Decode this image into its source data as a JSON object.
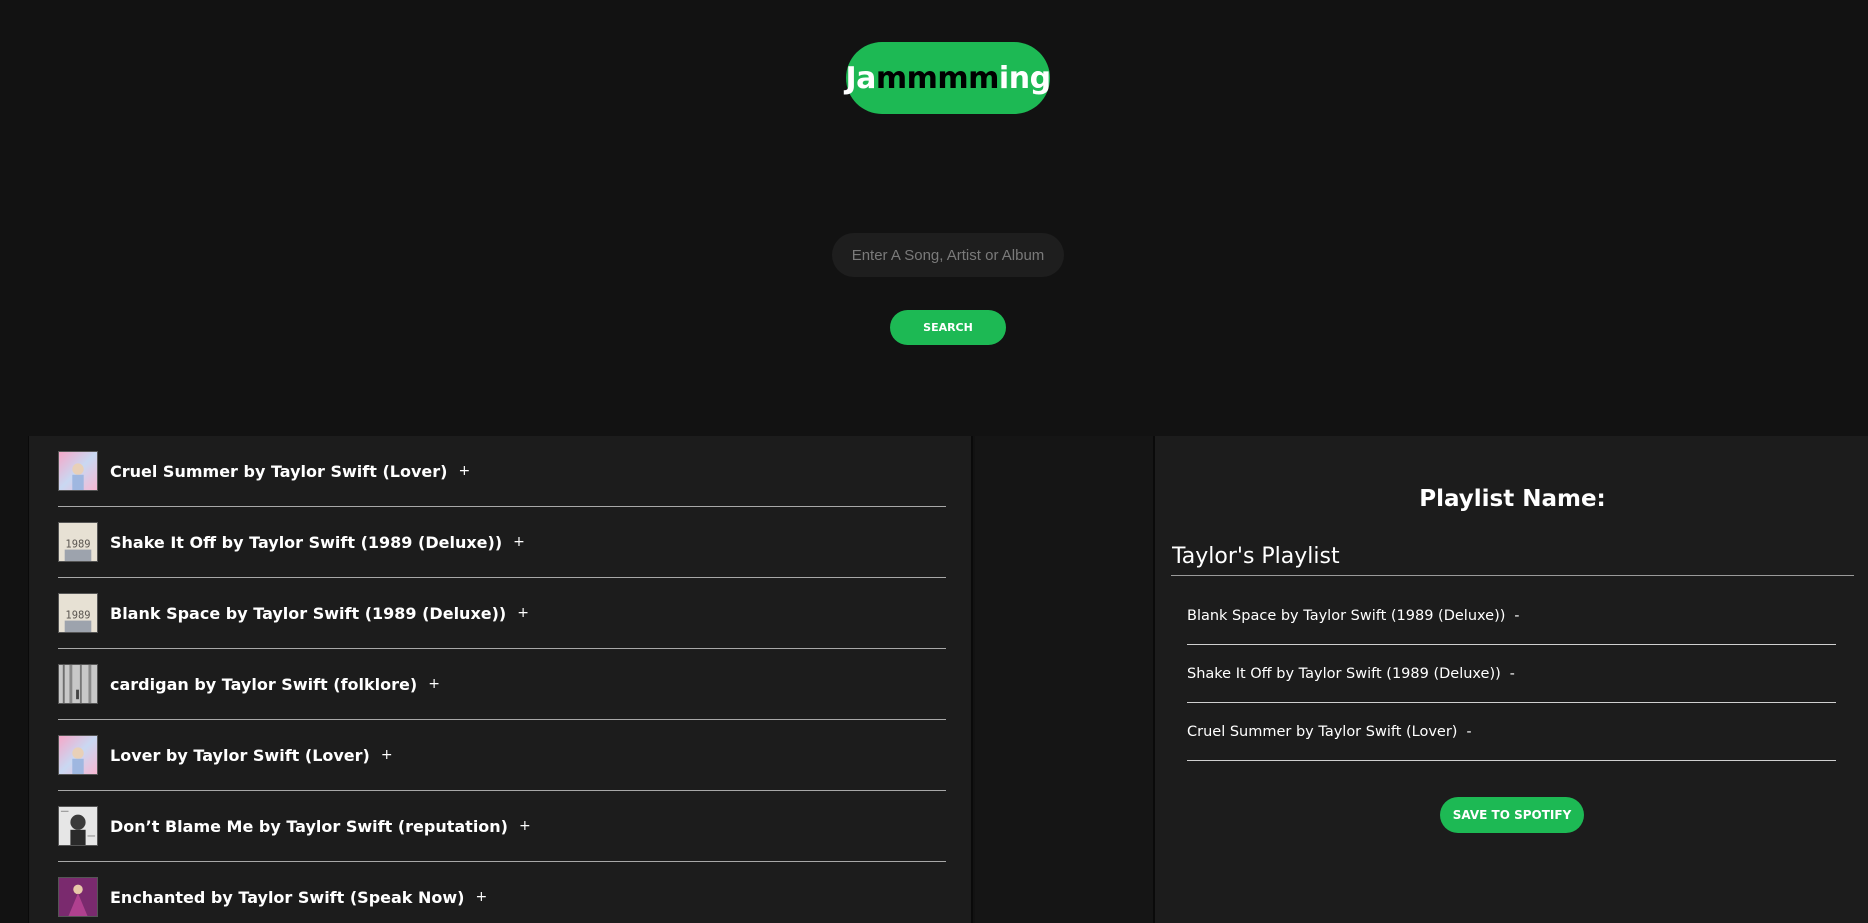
{
  "app": {
    "logo_part1": "Ja",
    "logo_part2": "mmmm",
    "logo_part3": "ing",
    "accent_color": "#1db954"
  },
  "search": {
    "placeholder": "Enter A Song, Artist or Album",
    "button_label": "Search"
  },
  "results": [
    {
      "title": "Cruel Summer by Taylor Swift (Lover)",
      "art": "lover-album-art",
      "add_label": "+"
    },
    {
      "title": "Shake It Off by Taylor Swift (1989 (Deluxe))",
      "art": "1989-album-art",
      "add_label": "+"
    },
    {
      "title": "Blank Space by Taylor Swift (1989 (Deluxe))",
      "art": "1989-album-art",
      "add_label": "+"
    },
    {
      "title": "cardigan by Taylor Swift (folklore)",
      "art": "folklore-album-art",
      "add_label": "+"
    },
    {
      "title": "Lover by Taylor Swift (Lover)",
      "art": "lover-album-art",
      "add_label": "+"
    },
    {
      "title": "Don’t Blame Me by Taylor Swift (reputation)",
      "art": "reputation-album-art",
      "add_label": "+"
    },
    {
      "title": "Enchanted by Taylor Swift (Speak Now)",
      "art": "speak-now-album-art",
      "add_label": "+"
    }
  ],
  "playlist": {
    "label": "Playlist Name:",
    "name_value": "Taylor's Playlist",
    "tracks": [
      {
        "title": "Blank Space by Taylor Swift (1989 (Deluxe))",
        "remove_label": "-"
      },
      {
        "title": "Shake It Off by Taylor Swift (1989 (Deluxe))",
        "remove_label": "-"
      },
      {
        "title": "Cruel Summer by Taylor Swift (Lover)",
        "remove_label": "-"
      }
    ],
    "save_label": "Save To Spotify"
  }
}
